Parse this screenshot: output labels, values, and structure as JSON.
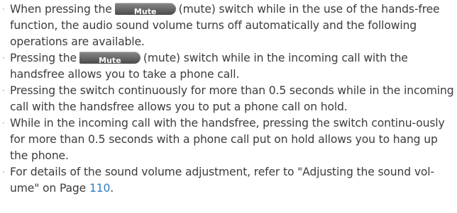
{
  "bullet_symbol": "·",
  "mute_button": {
    "label": "Mute"
  },
  "bullets": [
    {
      "before": "When pressing the",
      "after": "(mute) switch while in the use of the hands-free function, the audio sound volume turns off automatically and the following operations are available."
    },
    {
      "before": "Pressing the",
      "after": "(mute) switch while in the incoming call with the handsfree allows you to take a phone call."
    },
    {
      "text": "Pressing the switch continuously for more than 0.5 seconds while in the incoming call with the handsfree allows you to put a phone call on hold."
    },
    {
      "text": "While in the incoming call with the handsfree, pressing the switch continu-ously for more than 0.5 seconds with a phone call put on hold allows you to hang up the phone."
    },
    {
      "before": "For details of the sound volume adjustment, refer to \"Adjusting the sound vol-ume\" on Page",
      "page_ref": "110",
      "after": "."
    }
  ]
}
